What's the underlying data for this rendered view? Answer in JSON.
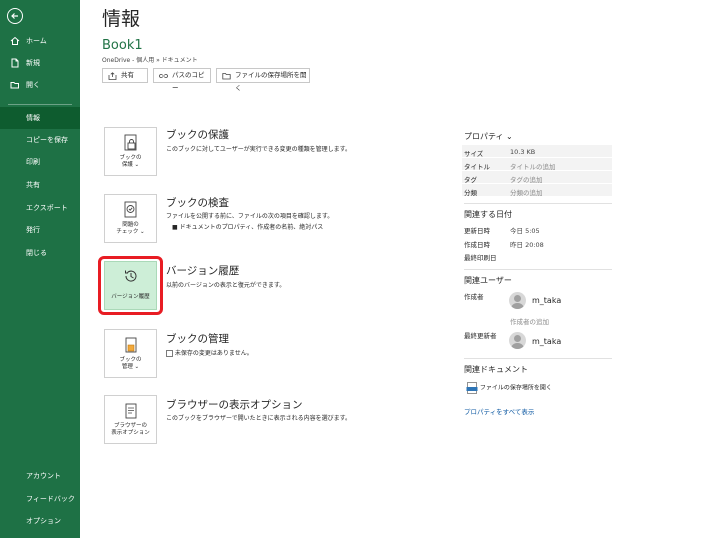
{
  "sidebar": {
    "items": [
      {
        "label": "ホーム",
        "icon": "home-icon"
      },
      {
        "label": "新規",
        "icon": "new-file-icon"
      },
      {
        "label": "開く",
        "icon": "folder-open-icon"
      },
      {
        "label": "情報"
      },
      {
        "label": "コピーを保存"
      },
      {
        "label": "印刷"
      },
      {
        "label": "共有"
      },
      {
        "label": "エクスポート"
      },
      {
        "label": "発行"
      },
      {
        "label": "閉じる"
      }
    ],
    "bottom_items": [
      {
        "label": "アカウント"
      },
      {
        "label": "フィードバック"
      },
      {
        "label": "オプション"
      }
    ],
    "active_color": "#0e5c2f",
    "bg_color": "#1e7145"
  },
  "main": {
    "title": "情報",
    "book_name": "Book1",
    "book_path": "OneDrive - 個人用 » ドキュメント",
    "buttons": {
      "share": "共有",
      "copy_path": "パスのコピー",
      "open_location": "ファイルの保存場所を開く"
    },
    "actions": {
      "protect": {
        "tile_line1": "ブックの",
        "tile_line2": "保護 ⌄",
        "title": "ブックの保護",
        "desc": "このブックに対してユーザーが実行できる変更の種類を管理します。"
      },
      "inspect": {
        "tile_line1": "問題の",
        "tile_line2": "チェック ⌄",
        "title": "ブックの検査",
        "desc": "ファイルを公開する前に、ファイルの次の項目を確認します。",
        "bullet": "ドキュメントのプロパティ、作成者の名前、絶対パス"
      },
      "version": {
        "tile_line1": "バージョン履歴",
        "title": "バージョン履歴",
        "desc": "以前のバージョンの表示と復元ができます。",
        "highlight_color": "#e81c23"
      },
      "manage": {
        "tile_line1": "ブックの",
        "tile_line2": "管理 ⌄",
        "title": "ブックの管理",
        "desc": "未保存の変更はありません。"
      },
      "browser": {
        "tile_line1": "ブラウザーの",
        "tile_line2": "表示オプション",
        "title": "ブラウザーの表示オプション",
        "desc": "このブックをブラウザーで開いたときに表示される内容を選びます。"
      }
    }
  },
  "properties": {
    "header": "プロパティ ⌄",
    "rows": [
      {
        "label": "サイズ",
        "value": "10.3 KB"
      },
      {
        "label": "タイトル",
        "value": "タイトルの追加"
      },
      {
        "label": "タグ",
        "value": "タグの追加"
      },
      {
        "label": "分類",
        "value": "分類の追加"
      }
    ],
    "dates_header": "関連する日付",
    "dates": [
      {
        "label": "更新日時",
        "value": "今日  5:05"
      },
      {
        "label": "作成日時",
        "value": "昨日  20:08"
      },
      {
        "label": "最終印刷日",
        "value": ""
      }
    ],
    "users_header": "関連ユーザー",
    "author_label": "作成者",
    "author_name": "m_taka",
    "add_author": "作成者の追加",
    "last_modified_label": "最終更新者",
    "last_modified_name": "m_taka",
    "docs_header": "関連ドキュメント",
    "open_location": "ファイルの保存場所を開く",
    "show_all": "プロパティをすべて表示"
  }
}
